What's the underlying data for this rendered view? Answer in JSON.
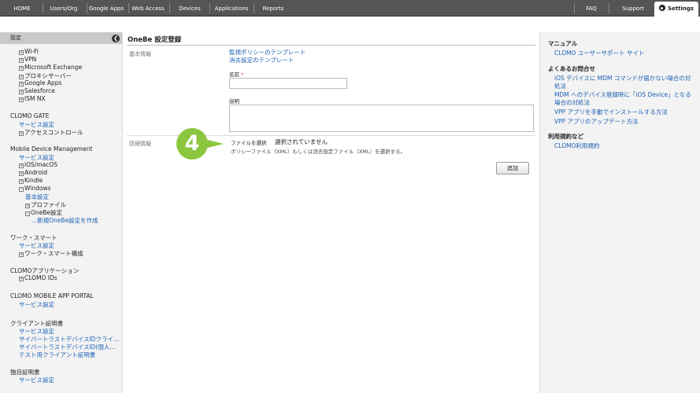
{
  "topnav": {
    "items": [
      "HOME",
      "Users/Org",
      "Google Apps",
      "Web Access",
      "Devices",
      "Applications",
      "Reports"
    ],
    "right_items": [
      "FAQ",
      "Support"
    ],
    "active_tab": "Settings"
  },
  "sidebar": {
    "header": "設定",
    "groups": [
      {
        "title": "",
        "items": [
          "Wi-Fi",
          "VPN",
          "Microsoft Exchange",
          "プロキシサーバー",
          "Google Apps",
          "Salesforce",
          "ISM NX"
        ]
      },
      {
        "title": "CLOMO GATE",
        "items": [
          "サービス設定",
          "アクセスコントロール"
        ]
      },
      {
        "title": "Mobile Device Management",
        "items": [
          "サービス設定",
          "iOS/macOS",
          "Android",
          "Kindle",
          "Windows",
          "基本設定",
          "プロファイル",
          "OneBe設定",
          "...新規OneBe設定を作成"
        ]
      },
      {
        "title": "ワーク・スマート",
        "items": [
          "サービス設定",
          "ワーク・スマート構成"
        ]
      },
      {
        "title": "CLOMOアプリケーション",
        "items": [
          "CLOMO IDs"
        ]
      },
      {
        "title": "CLOMO MOBILE APP PORTAL",
        "items": [
          "サービス設定"
        ]
      },
      {
        "title": "クライアント証明書",
        "items": [
          "サービス設定",
          "サイバートラストデバイスIDクライ...",
          "サイバートラストデバイスID(個人...",
          "テスト用クライアント証明書"
        ]
      },
      {
        "title": "独自証明書",
        "items": [
          "サービス設定"
        ]
      }
    ]
  },
  "main": {
    "title": "OneBe 設定登録",
    "basic_label": "基本情報",
    "template_links": [
      "監視ポリシーのテンプレート",
      "消去設定のテンプレート"
    ],
    "name_label": "名前",
    "required_mark": "*",
    "desc_label": "説明",
    "detail_label": "詳細情報",
    "file_button": "ファイルを選択",
    "file_status": "選択されていません",
    "file_help": "ポリシーファイル（XML）もしくは消去設定ファイル（XML）を選択する。",
    "add_button": "追加",
    "step_number": "4"
  },
  "rightpanel": {
    "sections": [
      {
        "title": "マニュアル",
        "links": [
          "CLOMO ユーザーサポート サイト"
        ]
      },
      {
        "title": "よくあるお問合せ",
        "links": [
          "iOS デバイスに MDM コマンドが届かない場合の対処法",
          "MDM へのデバイス登録時に「iOS Device」となる場合の対処法",
          "VPP アプリを手動でインストールする方法",
          "VPP アプリのアップデート方法"
        ]
      },
      {
        "title": "利用規約など",
        "links": [
          "CLOMO利用規約"
        ]
      }
    ]
  },
  "colors": {
    "accent": "#8cc63f",
    "link": "#1a5fb4",
    "nav": "#555555"
  }
}
